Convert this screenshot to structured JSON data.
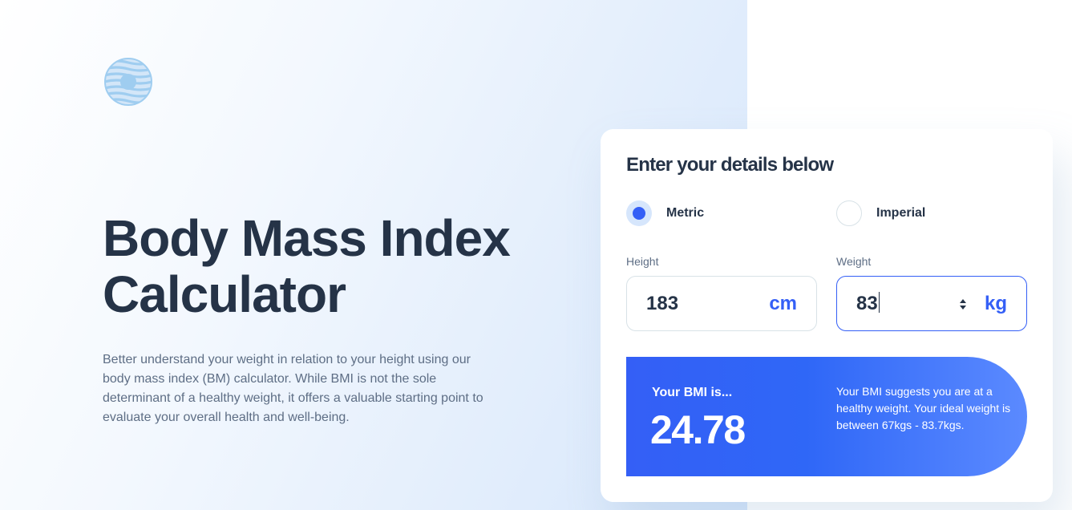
{
  "hero": {
    "title_line1": "Body Mass Index",
    "title_line2": "Calculator",
    "intro": "Better understand your weight in relation to your height using our body mass index (BM) calculator. While BMI is not the sole determinant of a healthy weight, it offers a valuable starting point to evaluate your overall health and well-being.",
    "logo_icon": "logo-icon"
  },
  "form": {
    "title": "Enter your details below",
    "units": {
      "options": [
        {
          "label": "Metric",
          "checked": true
        },
        {
          "label": "Imperial",
          "checked": false
        }
      ]
    },
    "height": {
      "label": "Height",
      "value": "183",
      "unit": "cm"
    },
    "weight": {
      "label": "Weight",
      "value": "83",
      "unit": "kg"
    }
  },
  "result": {
    "label": "Your BMI is...",
    "value": "24.78",
    "description": "Your BMI suggests you are at a healthy weight. Your ideal weight is between 67kgs - 83.7kgs."
  },
  "colors": {
    "accent": "#345ff6",
    "text_dark": "#253347",
    "text_muted": "#5e6e85",
    "border": "#d8e2e7"
  }
}
